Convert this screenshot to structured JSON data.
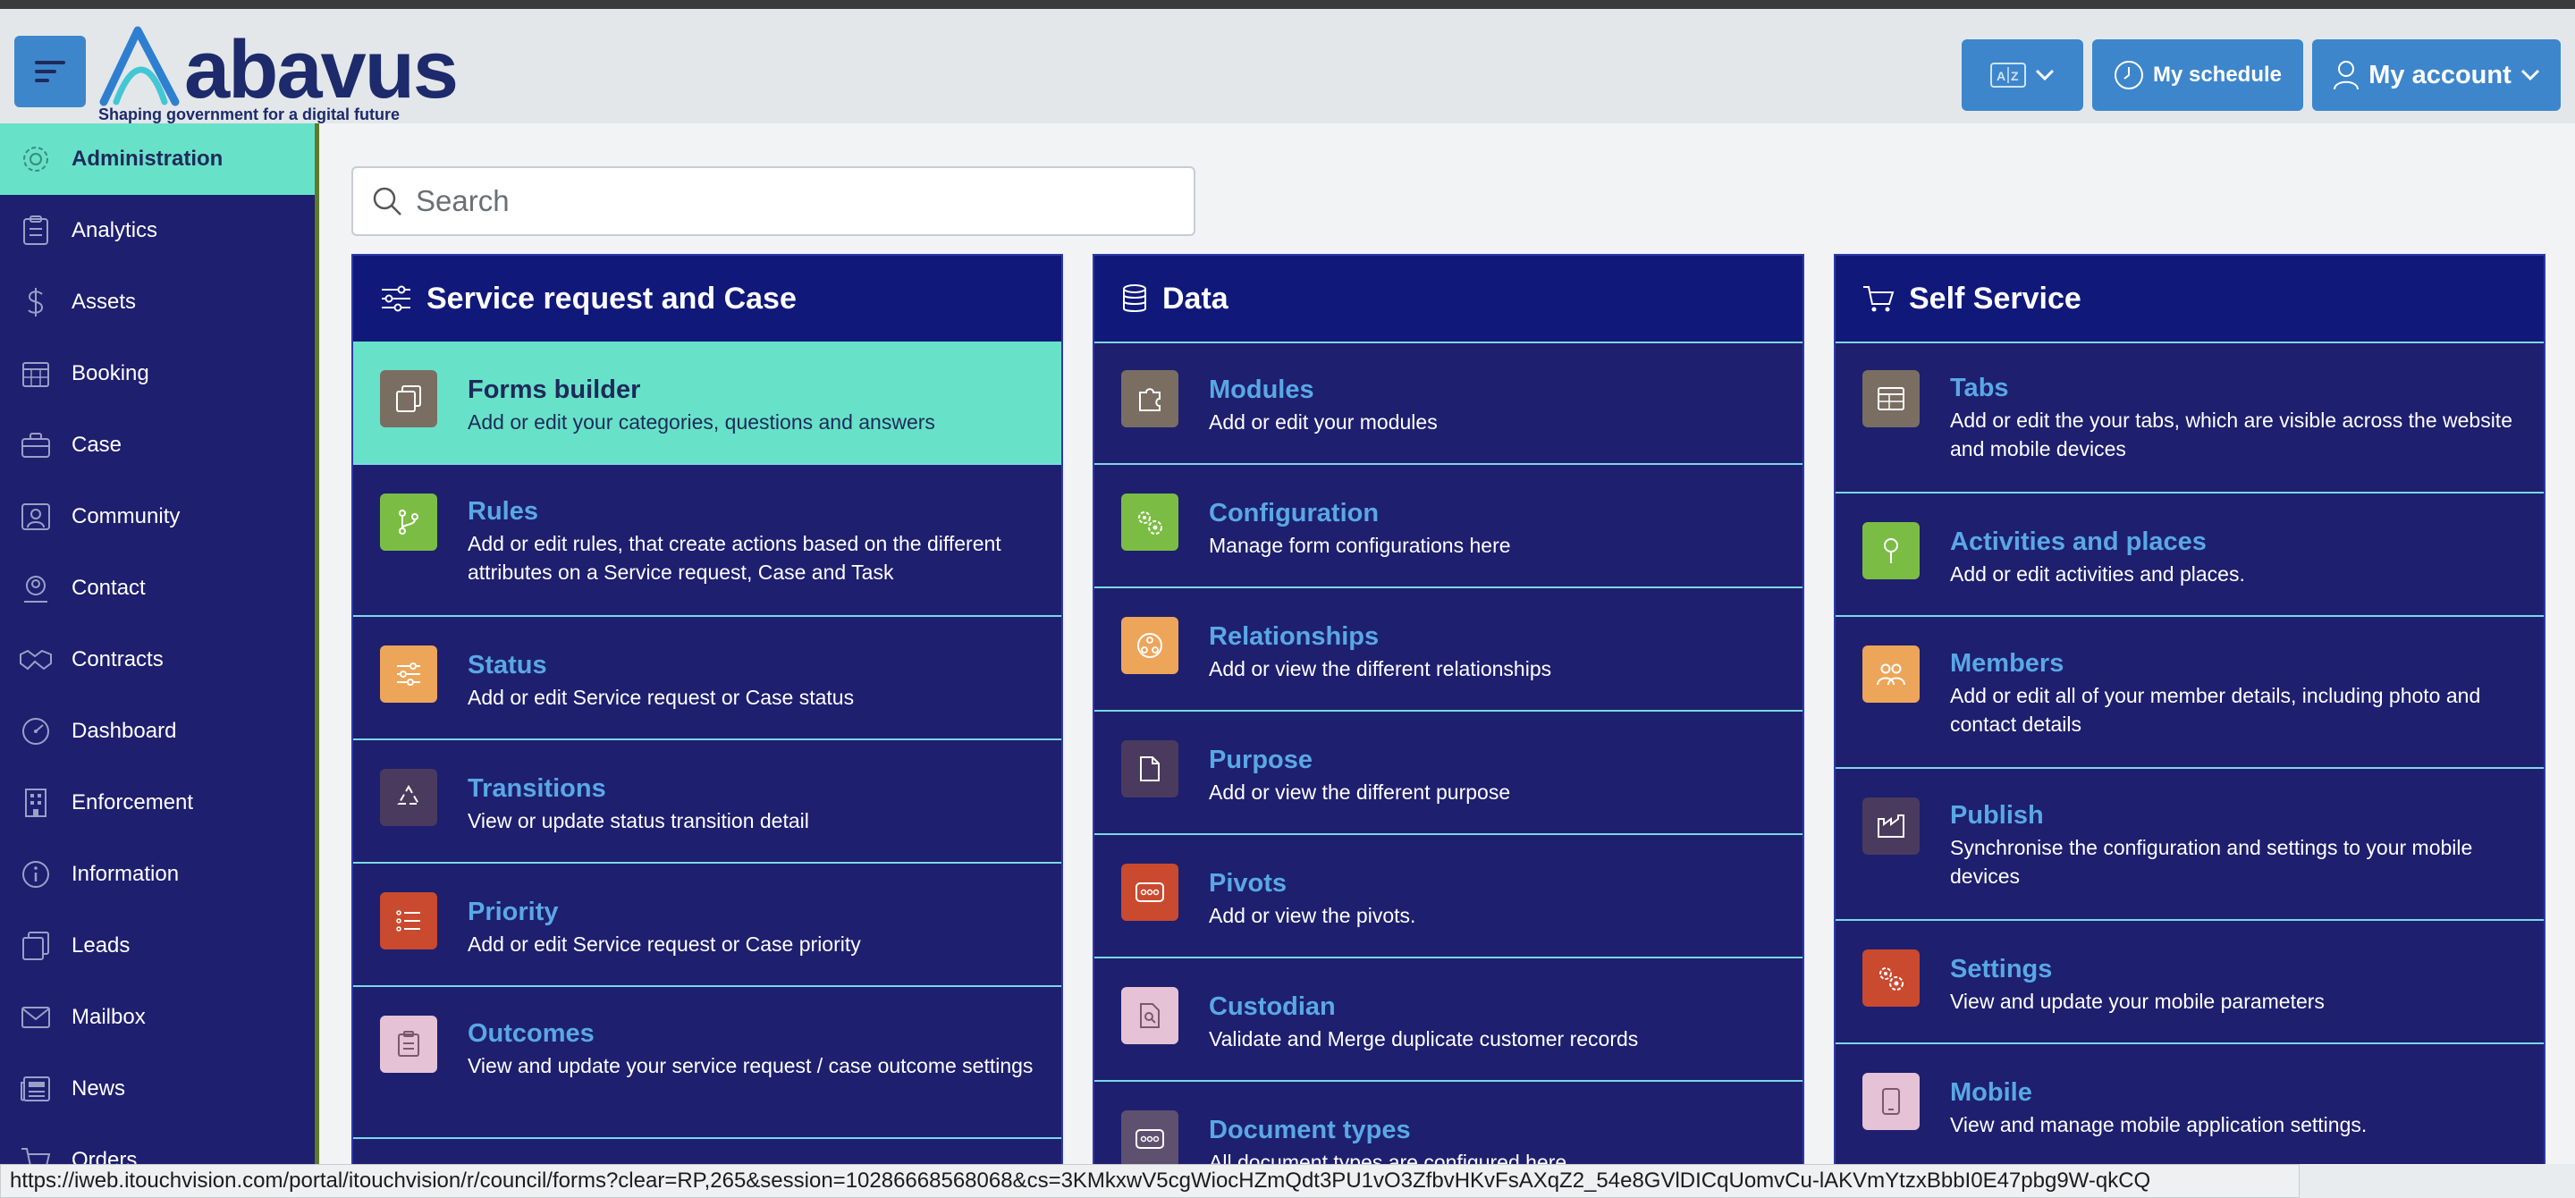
{
  "header": {
    "logo_text": "abavus",
    "logo_tagline": "Shaping government for a digital future",
    "schedule_label": "My schedule",
    "account_label": "My account"
  },
  "sidebar": {
    "items": [
      {
        "label": "Administration",
        "icon": "gear-icon",
        "active": true
      },
      {
        "label": "Analytics",
        "icon": "clipboard-icon"
      },
      {
        "label": "Assets",
        "icon": "dollar-icon"
      },
      {
        "label": "Booking",
        "icon": "calendar-icon"
      },
      {
        "label": "Case",
        "icon": "briefcase-icon"
      },
      {
        "label": "Community",
        "icon": "community-icon"
      },
      {
        "label": "Contact",
        "icon": "contact-icon"
      },
      {
        "label": "Contracts",
        "icon": "handshake-icon"
      },
      {
        "label": "Dashboard",
        "icon": "dashboard-icon"
      },
      {
        "label": "Enforcement",
        "icon": "building-icon"
      },
      {
        "label": "Information",
        "icon": "info-icon"
      },
      {
        "label": "Leads",
        "icon": "copy-icon"
      },
      {
        "label": "Mailbox",
        "icon": "mail-icon"
      },
      {
        "label": "News",
        "icon": "newspaper-icon"
      },
      {
        "label": "Orders",
        "icon": "cart-icon"
      }
    ]
  },
  "search": {
    "placeholder": "Search"
  },
  "panels": [
    {
      "title": "Service request and Case",
      "icon": "sliders-icon",
      "rows": [
        {
          "title": "Forms builder",
          "desc": "Add or edit your categories, questions and answers",
          "active": true,
          "tile": "#7a6e62",
          "icon": "copy-icon"
        },
        {
          "title": "Rules",
          "desc": "Add or edit rules, that create actions based on the different attributes on a Service request, Case and Task",
          "tile": "#7bbd44",
          "icon": "branch-icon"
        },
        {
          "title": "Status",
          "desc": "Add or edit Service request or Case status",
          "tile": "#eda55a",
          "icon": "sliders-icon"
        },
        {
          "title": "Transitions",
          "desc": "View or update status transition detail",
          "tile": "#4a3b5e",
          "icon": "recycle-icon"
        },
        {
          "title": "Priority",
          "desc": "Add or edit Service request or Case priority",
          "tile": "#c94a2e",
          "icon": "list-icon"
        },
        {
          "title": "Outcomes",
          "desc": "View and update your service request / case outcome settings",
          "tile": "#e6c2d6",
          "icon": "clipboard-icon"
        }
      ]
    },
    {
      "title": "Data",
      "icon": "database-icon",
      "rows": [
        {
          "title": "Modules",
          "desc": "Add or edit your modules",
          "tile": "#7a6e62",
          "icon": "puzzle-icon"
        },
        {
          "title": "Configuration",
          "desc": "Manage form configurations here",
          "tile": "#7bbd44",
          "icon": "gears-icon"
        },
        {
          "title": "Relationships",
          "desc": "Add or view the different relationships",
          "tile": "#eda55a",
          "icon": "network-icon"
        },
        {
          "title": "Purpose",
          "desc": "Add or view the different purpose",
          "tile": "#4a3b5e",
          "icon": "file-icon"
        },
        {
          "title": "Pivots",
          "desc": "Add or view the pivots.",
          "tile": "#c94a2e",
          "icon": "dots-icon"
        },
        {
          "title": "Custodian",
          "desc": "Validate and Merge duplicate customer records",
          "tile": "#e6c2d6",
          "icon": "file-search-icon"
        },
        {
          "title": "Document types",
          "desc": "All document types are configured here",
          "tile": "#5e5170",
          "icon": "dots-icon"
        }
      ]
    },
    {
      "title": "Self Service",
      "icon": "cart-icon",
      "rows": [
        {
          "title": "Tabs",
          "desc": "Add or edit the your tabs, which are visible across the website and mobile devices",
          "tile": "#7a6e62",
          "icon": "table-icon"
        },
        {
          "title": "Activities and places",
          "desc": "Add or edit activities and places.",
          "tile": "#7bbd44",
          "icon": "pin-icon"
        },
        {
          "title": "Members",
          "desc": "Add or edit all of your member details, including photo and contact details",
          "tile": "#eda55a",
          "icon": "users-icon"
        },
        {
          "title": "Publish",
          "desc": "Synchronise the configuration and settings to your mobile devices",
          "tile": "#4a3b5e",
          "icon": "factory-icon"
        },
        {
          "title": "Settings",
          "desc": "View and update your mobile parameters",
          "tile": "#c94a2e",
          "icon": "gears-icon"
        },
        {
          "title": "Mobile",
          "desc": "View and manage mobile application settings.",
          "tile": "#e6c2d6",
          "icon": "mobile-icon"
        }
      ]
    }
  ],
  "statusbar": {
    "url": "https://iweb.itouchvision.com/portal/itouchvision/r/council/forms?clear=RP,265&session=10286668568068&cs=3KMkxwV5cgWiocHZmQdt3PU1vO3ZfbvHKvFsAXqZ2_54e8GVlDICqUomvCu-lAKVmYtzxBbbI0E47pbg9W-qkCQ"
  }
}
